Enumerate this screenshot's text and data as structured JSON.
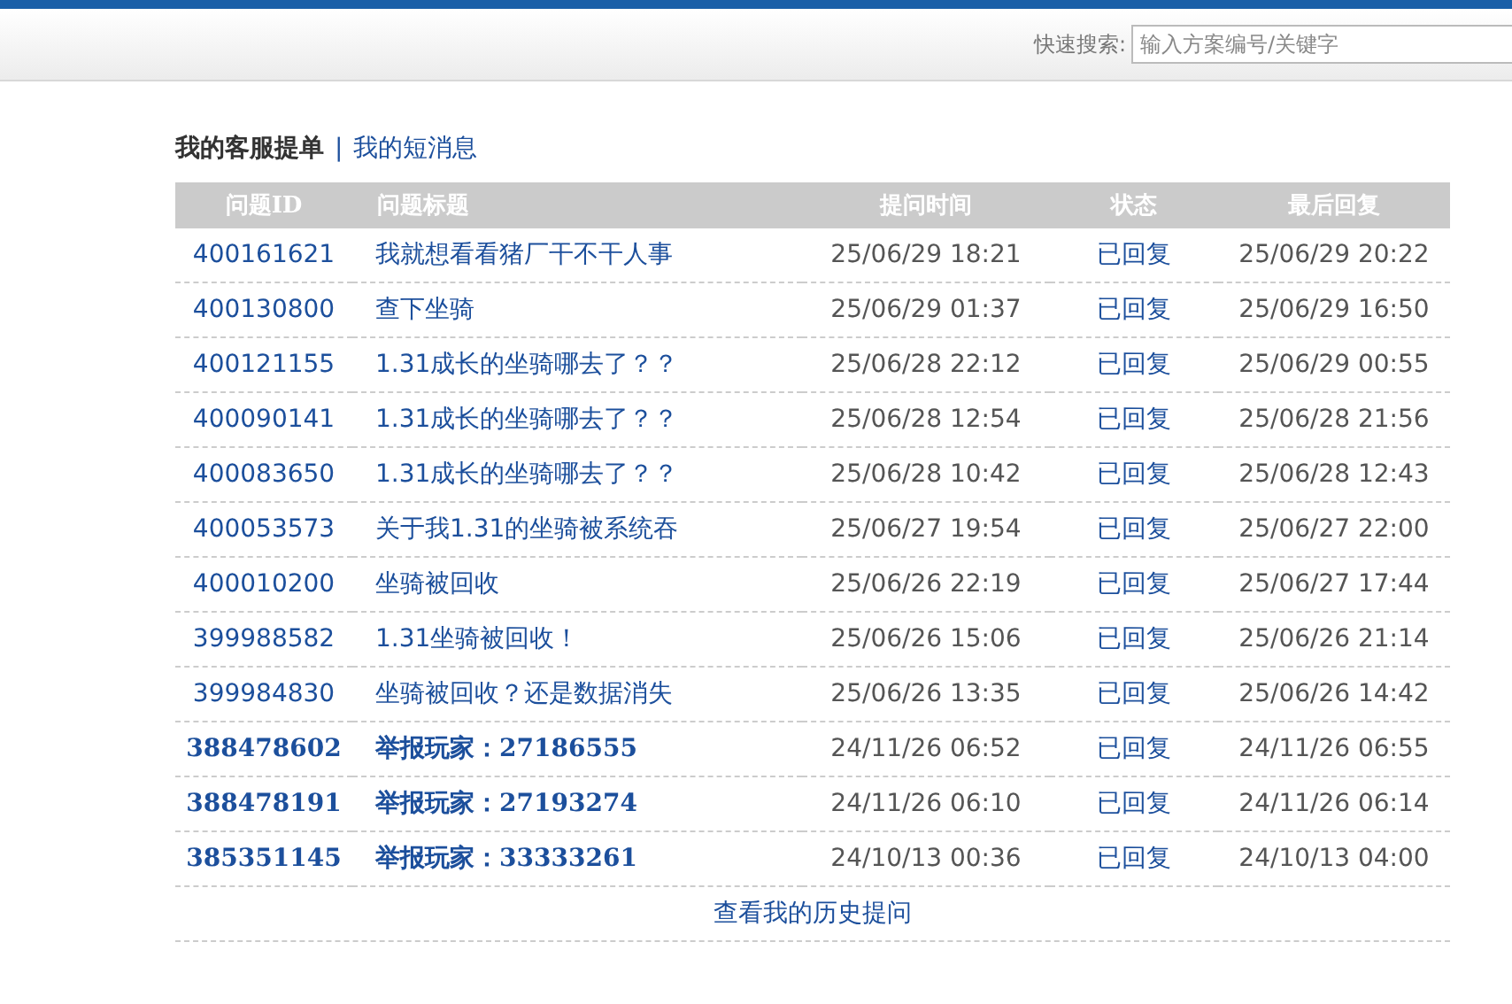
{
  "search": {
    "label": "快速搜索:",
    "placeholder": "输入方案编号/关键字"
  },
  "tabs": [
    {
      "label": "我的客服提单",
      "selected": true
    },
    {
      "label": "我的短消息",
      "selected": false
    }
  ],
  "tab_separator": "|",
  "table": {
    "columns": [
      "问题ID",
      "问题标题",
      "提问时间",
      "状态",
      "最后回复"
    ],
    "rows": [
      {
        "id": "400161621",
        "title": "我就想看看猪厂干不干人事",
        "asked": "25/06/29 18:21",
        "status": "已回复",
        "last_reply": "25/06/29 20:22",
        "emphasized": false
      },
      {
        "id": "400130800",
        "title": "查下坐骑",
        "asked": "25/06/29 01:37",
        "status": "已回复",
        "last_reply": "25/06/29 16:50",
        "emphasized": false
      },
      {
        "id": "400121155",
        "title": "1.31成长的坐骑哪去了？？",
        "asked": "25/06/28 22:12",
        "status": "已回复",
        "last_reply": "25/06/29 00:55",
        "emphasized": false
      },
      {
        "id": "400090141",
        "title": "1.31成长的坐骑哪去了？？",
        "asked": "25/06/28 12:54",
        "status": "已回复",
        "last_reply": "25/06/28 21:56",
        "emphasized": false
      },
      {
        "id": "400083650",
        "title": "1.31成长的坐骑哪去了？？",
        "asked": "25/06/28 10:42",
        "status": "已回复",
        "last_reply": "25/06/28 12:43",
        "emphasized": false
      },
      {
        "id": "400053573",
        "title": "关于我1.31的坐骑被系统吞",
        "asked": "25/06/27 19:54",
        "status": "已回复",
        "last_reply": "25/06/27 22:00",
        "emphasized": false
      },
      {
        "id": "400010200",
        "title": "坐骑被回收",
        "asked": "25/06/26 22:19",
        "status": "已回复",
        "last_reply": "25/06/27 17:44",
        "emphasized": false
      },
      {
        "id": "399988582",
        "title": "1.31坐骑被回收！",
        "asked": "25/06/26 15:06",
        "status": "已回复",
        "last_reply": "25/06/26 21:14",
        "emphasized": false
      },
      {
        "id": "399984830",
        "title": "坐骑被回收？还是数据消失",
        "asked": "25/06/26 13:35",
        "status": "已回复",
        "last_reply": "25/06/26 14:42",
        "emphasized": false
      },
      {
        "id": "388478602",
        "title": "举报玩家：27186555",
        "asked": "24/11/26 06:52",
        "status": "已回复",
        "last_reply": "24/11/26 06:55",
        "emphasized": true
      },
      {
        "id": "388478191",
        "title": "举报玩家：27193274",
        "asked": "24/11/26 06:10",
        "status": "已回复",
        "last_reply": "24/11/26 06:14",
        "emphasized": true
      },
      {
        "id": "385351145",
        "title": "举报玩家：33333261",
        "asked": "24/10/13 00:36",
        "status": "已回复",
        "last_reply": "24/10/13 04:00",
        "emphasized": true
      }
    ]
  },
  "history_link": "查看我的历史提问"
}
